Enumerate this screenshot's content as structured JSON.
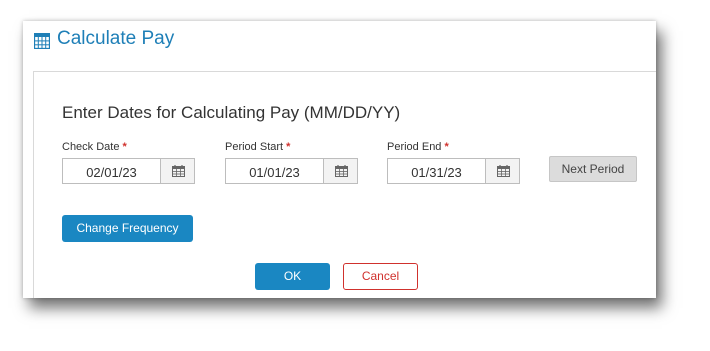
{
  "dialog": {
    "title": "Calculate Pay",
    "title_icon": "calculator-icon",
    "heading": "Enter Dates for Calculating Pay (MM/DD/YY)"
  },
  "fields": [
    {
      "label": "Check Date",
      "required_mark": "*",
      "value": "02/01/23",
      "icon": "calendar-icon"
    },
    {
      "label": "Period Start",
      "required_mark": "*",
      "value": "01/01/23",
      "icon": "calendar-icon"
    },
    {
      "label": "Period End",
      "required_mark": "*",
      "value": "01/31/23",
      "icon": "calendar-icon"
    }
  ],
  "buttons": {
    "next_period": "Next Period",
    "change_frequency": "Change Frequency",
    "ok": "OK",
    "cancel": "Cancel"
  },
  "colors": {
    "accent": "#1a87c2",
    "title": "#1e7fb7",
    "required": "#d0312d",
    "cancel": "#d0312d"
  }
}
